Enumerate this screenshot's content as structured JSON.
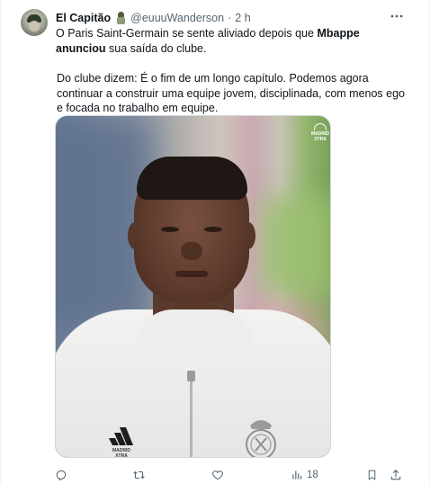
{
  "tweet": {
    "author_name": "El Capitão",
    "author_handle": "@euuuWanderson",
    "separator": "·",
    "time": "2 h",
    "text_before": "O Paris Saint-Germain se sente aliviado depois que ",
    "text_bold": "Mbappe anunciou",
    "text_after": " sua saída do clube.",
    "text_para2": "Do clube dizem: É o fim de um longo capítulo.  Podemos agora continuar a construir uma equipe jovem, disciplinada, com menos ego e focada no trabalho em equipe.",
    "media_logo_text": "MADRID XTRA",
    "adidas_text": "MADRID XTRA"
  },
  "actions": {
    "views_count": "18"
  },
  "icons": {
    "more": "more-dots-icon",
    "reply": "reply-icon",
    "retweet": "retweet-icon",
    "like": "like-icon",
    "views": "views-icon",
    "share": "share-icon"
  },
  "colors": {
    "text": "#0f1419",
    "muted": "#536471",
    "border": "#cfd9de"
  }
}
